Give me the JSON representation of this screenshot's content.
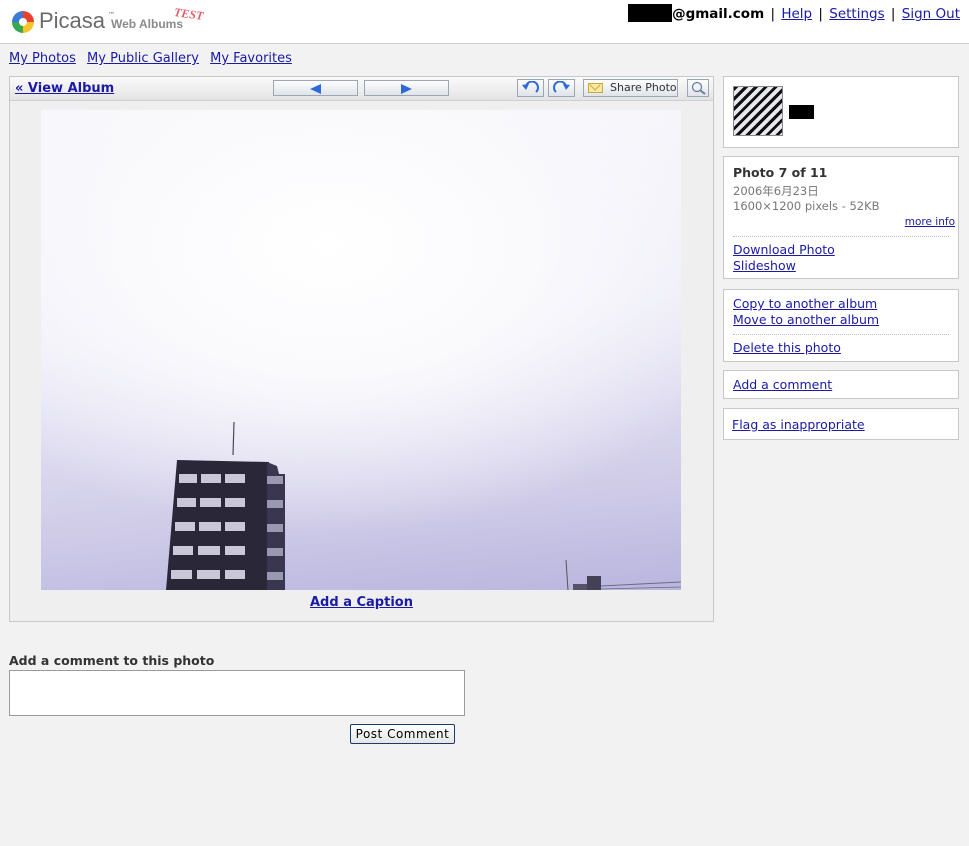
{
  "header": {
    "brand": "Picasa",
    "brand_tm": "™",
    "brand_sub": "Web Albums",
    "brand_badge": "TEST",
    "user_email_suffix": "@gmail.com",
    "links": [
      "Help",
      "Settings",
      "Sign Out"
    ],
    "separator": "|"
  },
  "nav": {
    "items": [
      "My Photos",
      "My Public Gallery",
      "My Favorites"
    ]
  },
  "toolbar": {
    "back_label": "« View Album",
    "share_label": "Share Photo"
  },
  "photo": {
    "caption_link": "Add a Caption"
  },
  "comment": {
    "label": "Add a comment to this photo",
    "input_value": "",
    "post_label": "Post Comment"
  },
  "sidebar": {
    "photo_title": "Photo 7 of 11",
    "date": "2006年6月23日",
    "dimensions": "1600×1200 pixels - 52KB",
    "more_info": "more info",
    "download": "Download Photo",
    "slideshow": "Slideshow",
    "copy": "Copy to another album",
    "move": "Move to another album",
    "delete": "Delete this photo",
    "add_comment": "Add a comment",
    "flag": "Flag as inappropriate"
  },
  "colors": {
    "link": "#1a1aa6",
    "page_bg": "#f2f2f2",
    "accent_blue": "#2d6ad8"
  }
}
